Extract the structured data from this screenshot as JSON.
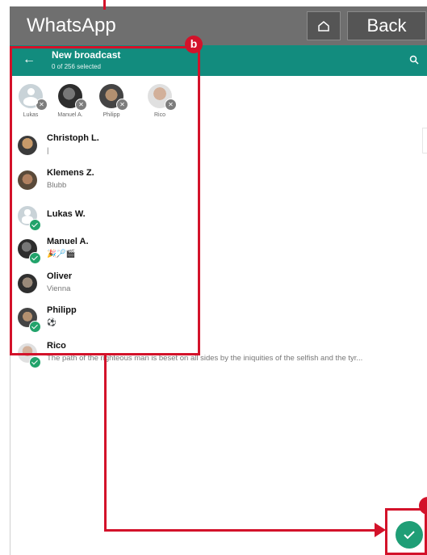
{
  "app": {
    "title": "WhatsApp",
    "back_label": "Back"
  },
  "header": {
    "title": "New broadcast",
    "subtitle": "0 of 256 selected"
  },
  "selected": [
    {
      "name": "Lukas"
    },
    {
      "name": "Manuel A."
    },
    {
      "name": "Philipp"
    },
    {
      "name": "Rico"
    }
  ],
  "contacts": [
    {
      "name": "Christoph L.",
      "status": "|"
    },
    {
      "name": "Klemens Z.",
      "status": "Blubb"
    },
    {
      "name": "Lukas W.",
      "status": ""
    },
    {
      "name": "Manuel A.",
      "status": "🎉🏸🎬"
    },
    {
      "name": "Oliver",
      "status": "Vienna"
    },
    {
      "name": "Philipp",
      "status": "⚽"
    },
    {
      "name": "Rico",
      "status": "The path of the righteous man is beset on all sides by the iniquities of the selfish and the tyr..."
    }
  ],
  "annotations": {
    "badge_b": "b"
  },
  "colors": {
    "whatsapp_green": "#128c7e",
    "accent_red": "#d3122a",
    "check_green": "#22a36b",
    "fab_green": "#1f9e76"
  }
}
